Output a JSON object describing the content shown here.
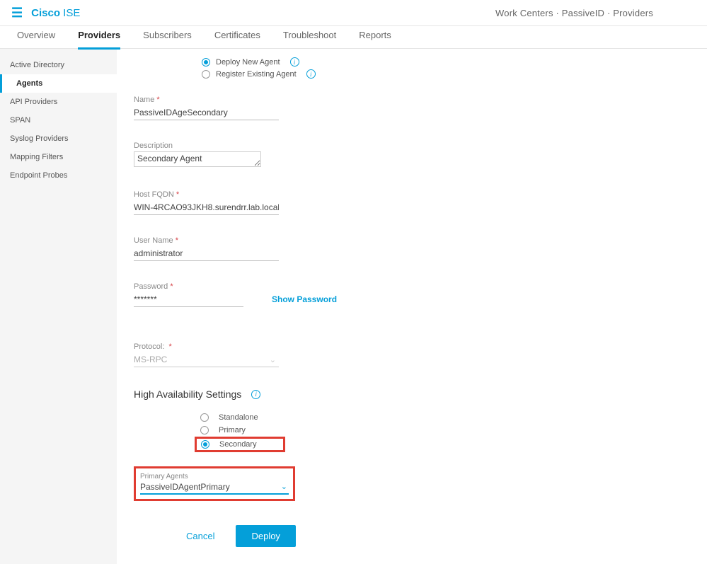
{
  "header": {
    "brand_cisco": "Cisco",
    "brand_ise": " ISE",
    "breadcrumb": "Work Centers · PassiveID · Providers"
  },
  "tabs": [
    {
      "label": "Overview"
    },
    {
      "label": "Providers"
    },
    {
      "label": "Subscribers"
    },
    {
      "label": "Certificates"
    },
    {
      "label": "Troubleshoot"
    },
    {
      "label": "Reports"
    }
  ],
  "active_tab": "Providers",
  "sidebar": {
    "items": [
      {
        "label": "Active Directory"
      },
      {
        "label": "Agents"
      },
      {
        "label": "API Providers"
      },
      {
        "label": "SPAN"
      },
      {
        "label": "Syslog Providers"
      },
      {
        "label": "Mapping Filters"
      },
      {
        "label": "Endpoint Probes"
      }
    ],
    "active": "Agents"
  },
  "deploy_options": {
    "deploy_new": "Deploy New Agent",
    "register_existing": "Register Existing Agent",
    "selected": "deploy_new"
  },
  "form": {
    "name_label": "Name",
    "name_value": "PassiveIDAgeSecondary",
    "description_label": "Description",
    "description_value": "Secondary Agent",
    "host_label": "Host FQDN",
    "host_value": "WIN-4RCAO93JKH8.surendrr.lab.local",
    "username_label": "User Name",
    "username_value": "administrator",
    "password_label": "Password",
    "password_value": "*******",
    "show_password": "Show Password",
    "protocol_label": "Protocol:",
    "protocol_value": "MS-RPC"
  },
  "ha": {
    "title": "High Availability Settings",
    "options": {
      "standalone": "Standalone",
      "primary": "Primary",
      "secondary": "Secondary"
    },
    "selected": "secondary",
    "primary_agents_label": "Primary Agents",
    "primary_agents_value": "PassiveIDAgentPrimary"
  },
  "footer": {
    "cancel": "Cancel",
    "deploy": "Deploy"
  }
}
